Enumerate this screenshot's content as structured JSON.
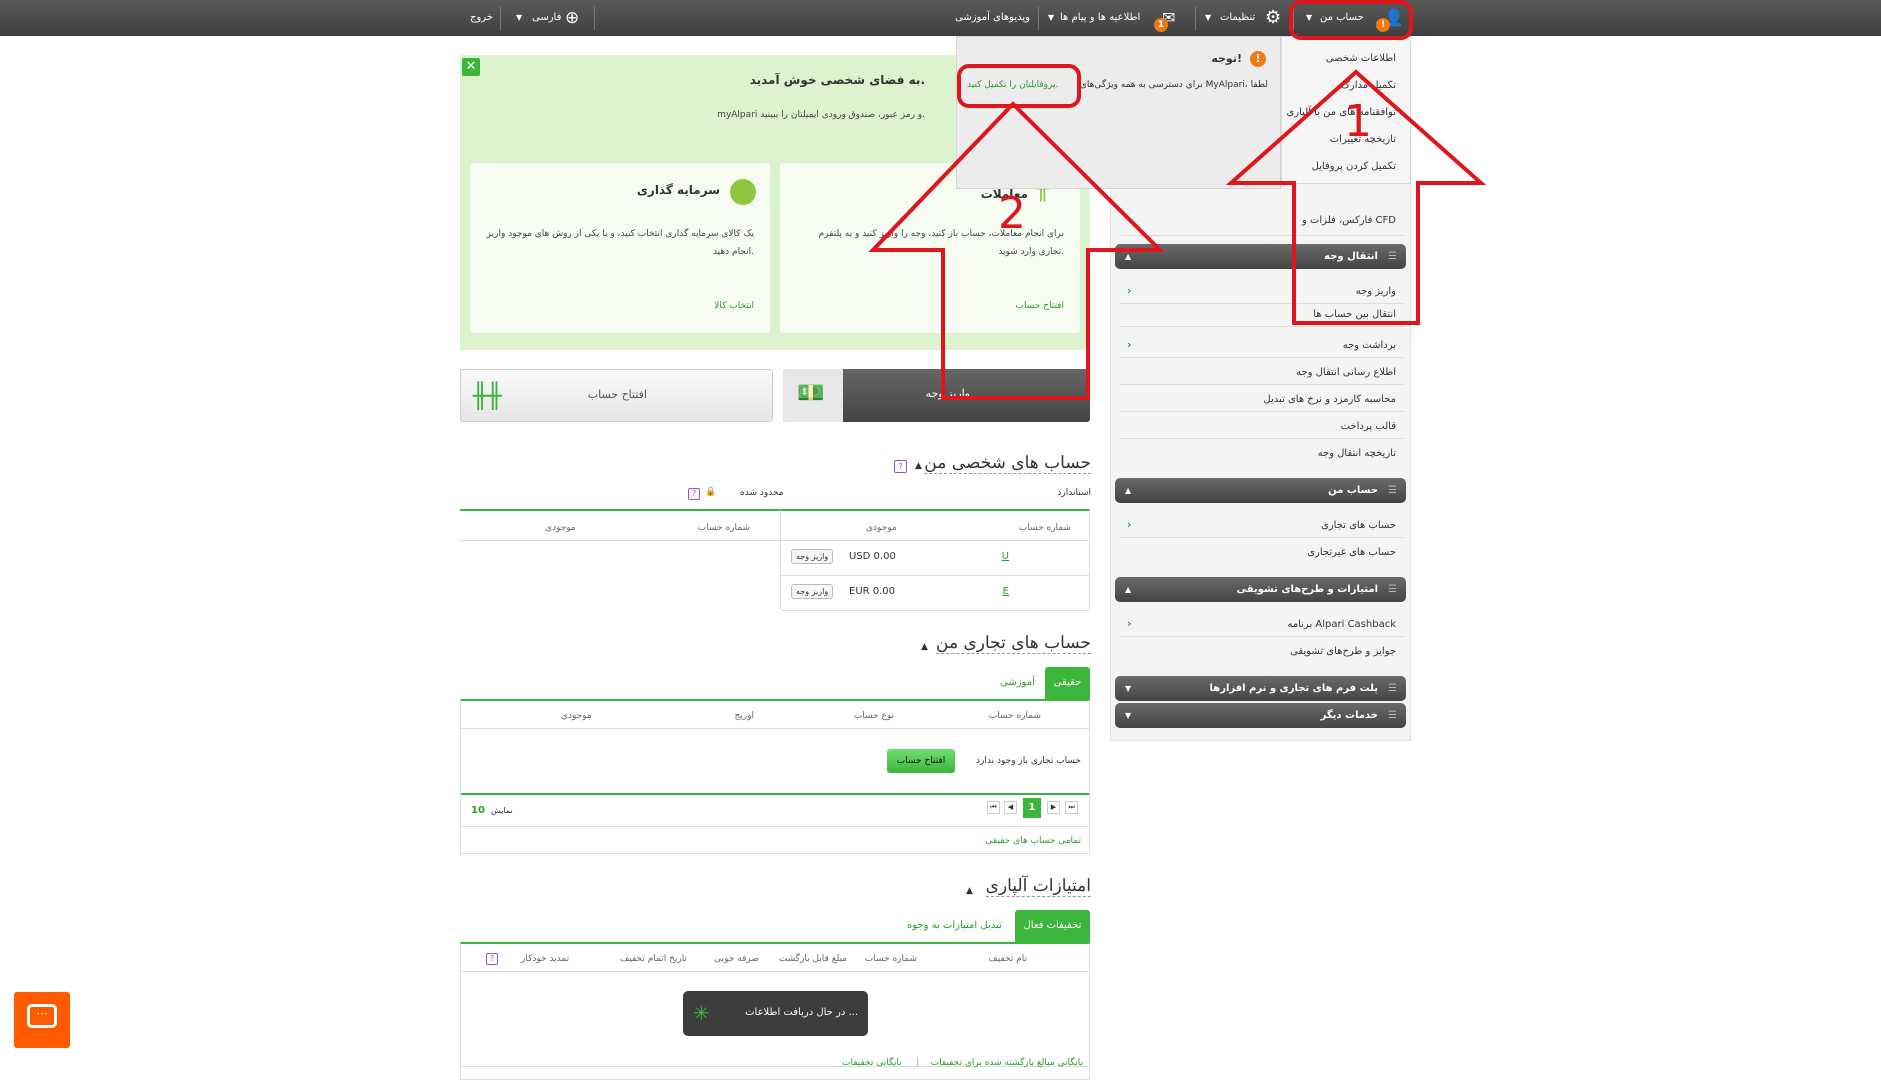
{
  "topbar": {
    "account_menu": "حساب من",
    "settings": "تنظیمات",
    "messages": "اطلاعیه ها و پیام ها",
    "messages_badge": "1",
    "account_badge": "!",
    "tutorials": "ویدیوهای آموزشی",
    "language": "فارسی",
    "logout": "خروج"
  },
  "notice": {
    "title": "توجه!",
    "text": "برای دسترسی به همه ویژگی‌های MyAlpari، لطفا",
    "link": "پروفایلتان را تکمیل کنید."
  },
  "account_dropdown": {
    "items": [
      "اطلاعات شخصی",
      "تکمیل مدارک",
      "توافقنامه های من با آلپاری",
      "تاریخچه تغییرات",
      "تکمیل کردن پروفایل"
    ]
  },
  "welcome": {
    "title": "به فضای شخصی خوش آمدید.",
    "subtitle": "myAlpari و رمز عبور، صندوق ورودی ایمیلتان را ببینید.",
    "cards": [
      {
        "title": "سرمایه گذاری",
        "text": "یک کالای سرمایه گذاری انتخاب کنید، و با یکی از روش های موجود واریز انجام دهید.",
        "link": "انتخاب کالا"
      },
      {
        "title": "معاملات",
        "text": "برای انجام معاملات، حساب باز کنید، وجه را واریز کنید و به پلتفرم تجاری وارد شوید.",
        "link": "افتتاح حساب"
      }
    ]
  },
  "action_buttons": {
    "open_account": "افتتاح حساب",
    "deposit": "واریز وجه"
  },
  "personal_accounts": {
    "title": "حساب های شخصی من",
    "standard_label": "استاندارد",
    "limited_label": "محدود شده",
    "col_account": "شماره حساب",
    "col_balance": "موجودی",
    "rows": [
      {
        "account": "U",
        "balance": "USD 0.00",
        "action": "واریز وجه"
      },
      {
        "account": "E",
        "balance": "EUR 0.00",
        "action": "واریز وجه"
      }
    ]
  },
  "trading_accounts": {
    "title": "حساب های تجاری من",
    "tab_real": "حقیقی",
    "tab_demo": "آموزشی",
    "columns": [
      "شماره حساب",
      "نوع حساب",
      "اوریج",
      "موجودی"
    ],
    "empty_text": "حساب تجاری باز وجود ندارد",
    "open_button": "افتتاح حساب",
    "page": "1",
    "show_label": "نمایش",
    "show_value": "10",
    "all_real": "تمامی حساب های حقیقی"
  },
  "points": {
    "title": "امتیازات آلپاری",
    "tab_active": "تخفیفات فعال",
    "tab_convert": "تبدیل امتیازات به وجوه",
    "columns": [
      "نام تخفیف",
      "شماره حساب",
      "مبلغ قابل بازگشت",
      "صرفه جویی",
      "تاریخ اتمام تخفیف",
      "تمدید خودکار"
    ],
    "loading": "در حال دریافت اطلاعات ...",
    "link_archive": "بایگانی تخفیفات",
    "link_refunds": "بایگانی مبالغ بازگشته شده برای تخفیفات"
  },
  "sidebar": {
    "forex": "فارکس، فلزات و CFD",
    "transfer_head": "انتقال وجه",
    "transfer_items": [
      "واریز وجه",
      "انتقال بین حساب ها",
      "برداشت وجه",
      "اطلاع رسانی انتقال وجه",
      "محاسبه کارمزد و نرخ های تبدیل",
      "قالب پرداخت",
      "تاریخچه انتقال وجه"
    ],
    "account_head": "حساب من",
    "account_items": [
      "حساب های تجاری",
      "حساب های غیرتجاری"
    ],
    "promo_head": "امتیازات و طرح‌های تشویقی",
    "promo_items": [
      "برنامه Alpari Cashback",
      "جوایز و طرح‌های تشویقی"
    ],
    "platforms_head": "پلت فرم های تجاری و نرم افزارها",
    "services_head": "خدمات دیگر"
  },
  "annotations": {
    "label_1": "1",
    "label_2": "2"
  },
  "colors": {
    "accent": "#3bb53b",
    "annotation": "#e0161e",
    "topbar": "#4b4b4b",
    "badge": "#f07a12",
    "chat": "#ff5a00"
  }
}
